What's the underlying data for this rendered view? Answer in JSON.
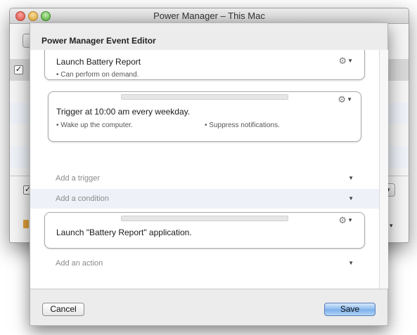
{
  "window": {
    "title": "Power Manager – This Mac"
  },
  "editor": {
    "title": "Power Manager Event Editor",
    "event": {
      "title": "Launch Battery Report",
      "note": "• Can perform on demand."
    },
    "trigger": {
      "title": "Trigger at 10:00 am every weekday.",
      "notes": [
        "• Wake up the computer.",
        "• Suppress notifications."
      ]
    },
    "add_trigger": "Add a trigger",
    "add_condition": "Add a condition",
    "action": {
      "title": "Launch \"Battery Report\" application."
    },
    "add_action": "Add an action",
    "cancel_label": "Cancel",
    "save_label": "Save"
  },
  "icons": {
    "gear": "gear-icon",
    "caret": "chevron-down-icon",
    "checkbox": "checkmark-icon"
  },
  "colors": {
    "accent": "#7aafe9",
    "selection_row": "#d7d7d7",
    "condition_row": "#eef2f8",
    "muted_text": "#8a8a8a"
  }
}
